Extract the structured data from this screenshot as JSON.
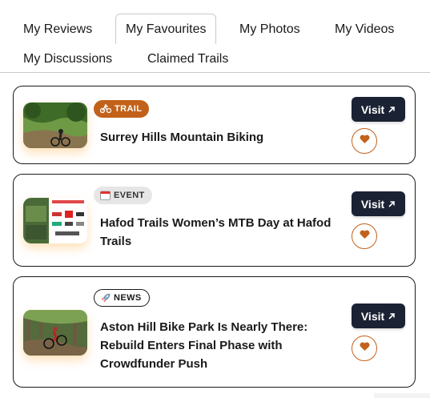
{
  "tabs": [
    {
      "label": "My Reviews",
      "active": false
    },
    {
      "label": "My Favourites",
      "active": true
    },
    {
      "label": "My Photos",
      "active": false
    },
    {
      "label": "My Videos",
      "active": false
    },
    {
      "label": "My Discussions",
      "active": false
    },
    {
      "label": "Claimed Trails",
      "active": false
    }
  ],
  "colors": {
    "accent": "#c2611a",
    "button": "#1a2233",
    "border": "#1a1a1a"
  },
  "favourites": [
    {
      "badge": "TRAIL",
      "badge_icon": "bike-icon",
      "title": "Surrey Hills Mountain Biking",
      "visit_label": "Visit",
      "favourite": true
    },
    {
      "badge": "EVENT",
      "badge_icon": "calendar-icon",
      "title": "Hafod Trails Women’s MTB Day at Hafod Trails",
      "visit_label": "Visit",
      "favourite": true
    },
    {
      "badge": "NEWS",
      "badge_icon": "rocket-icon",
      "title": "Aston Hill Bike Park Is Nearly There: Rebuild Enters Final Phase with Crowdfunder Push",
      "visit_label": "Visit",
      "favourite": true
    }
  ]
}
